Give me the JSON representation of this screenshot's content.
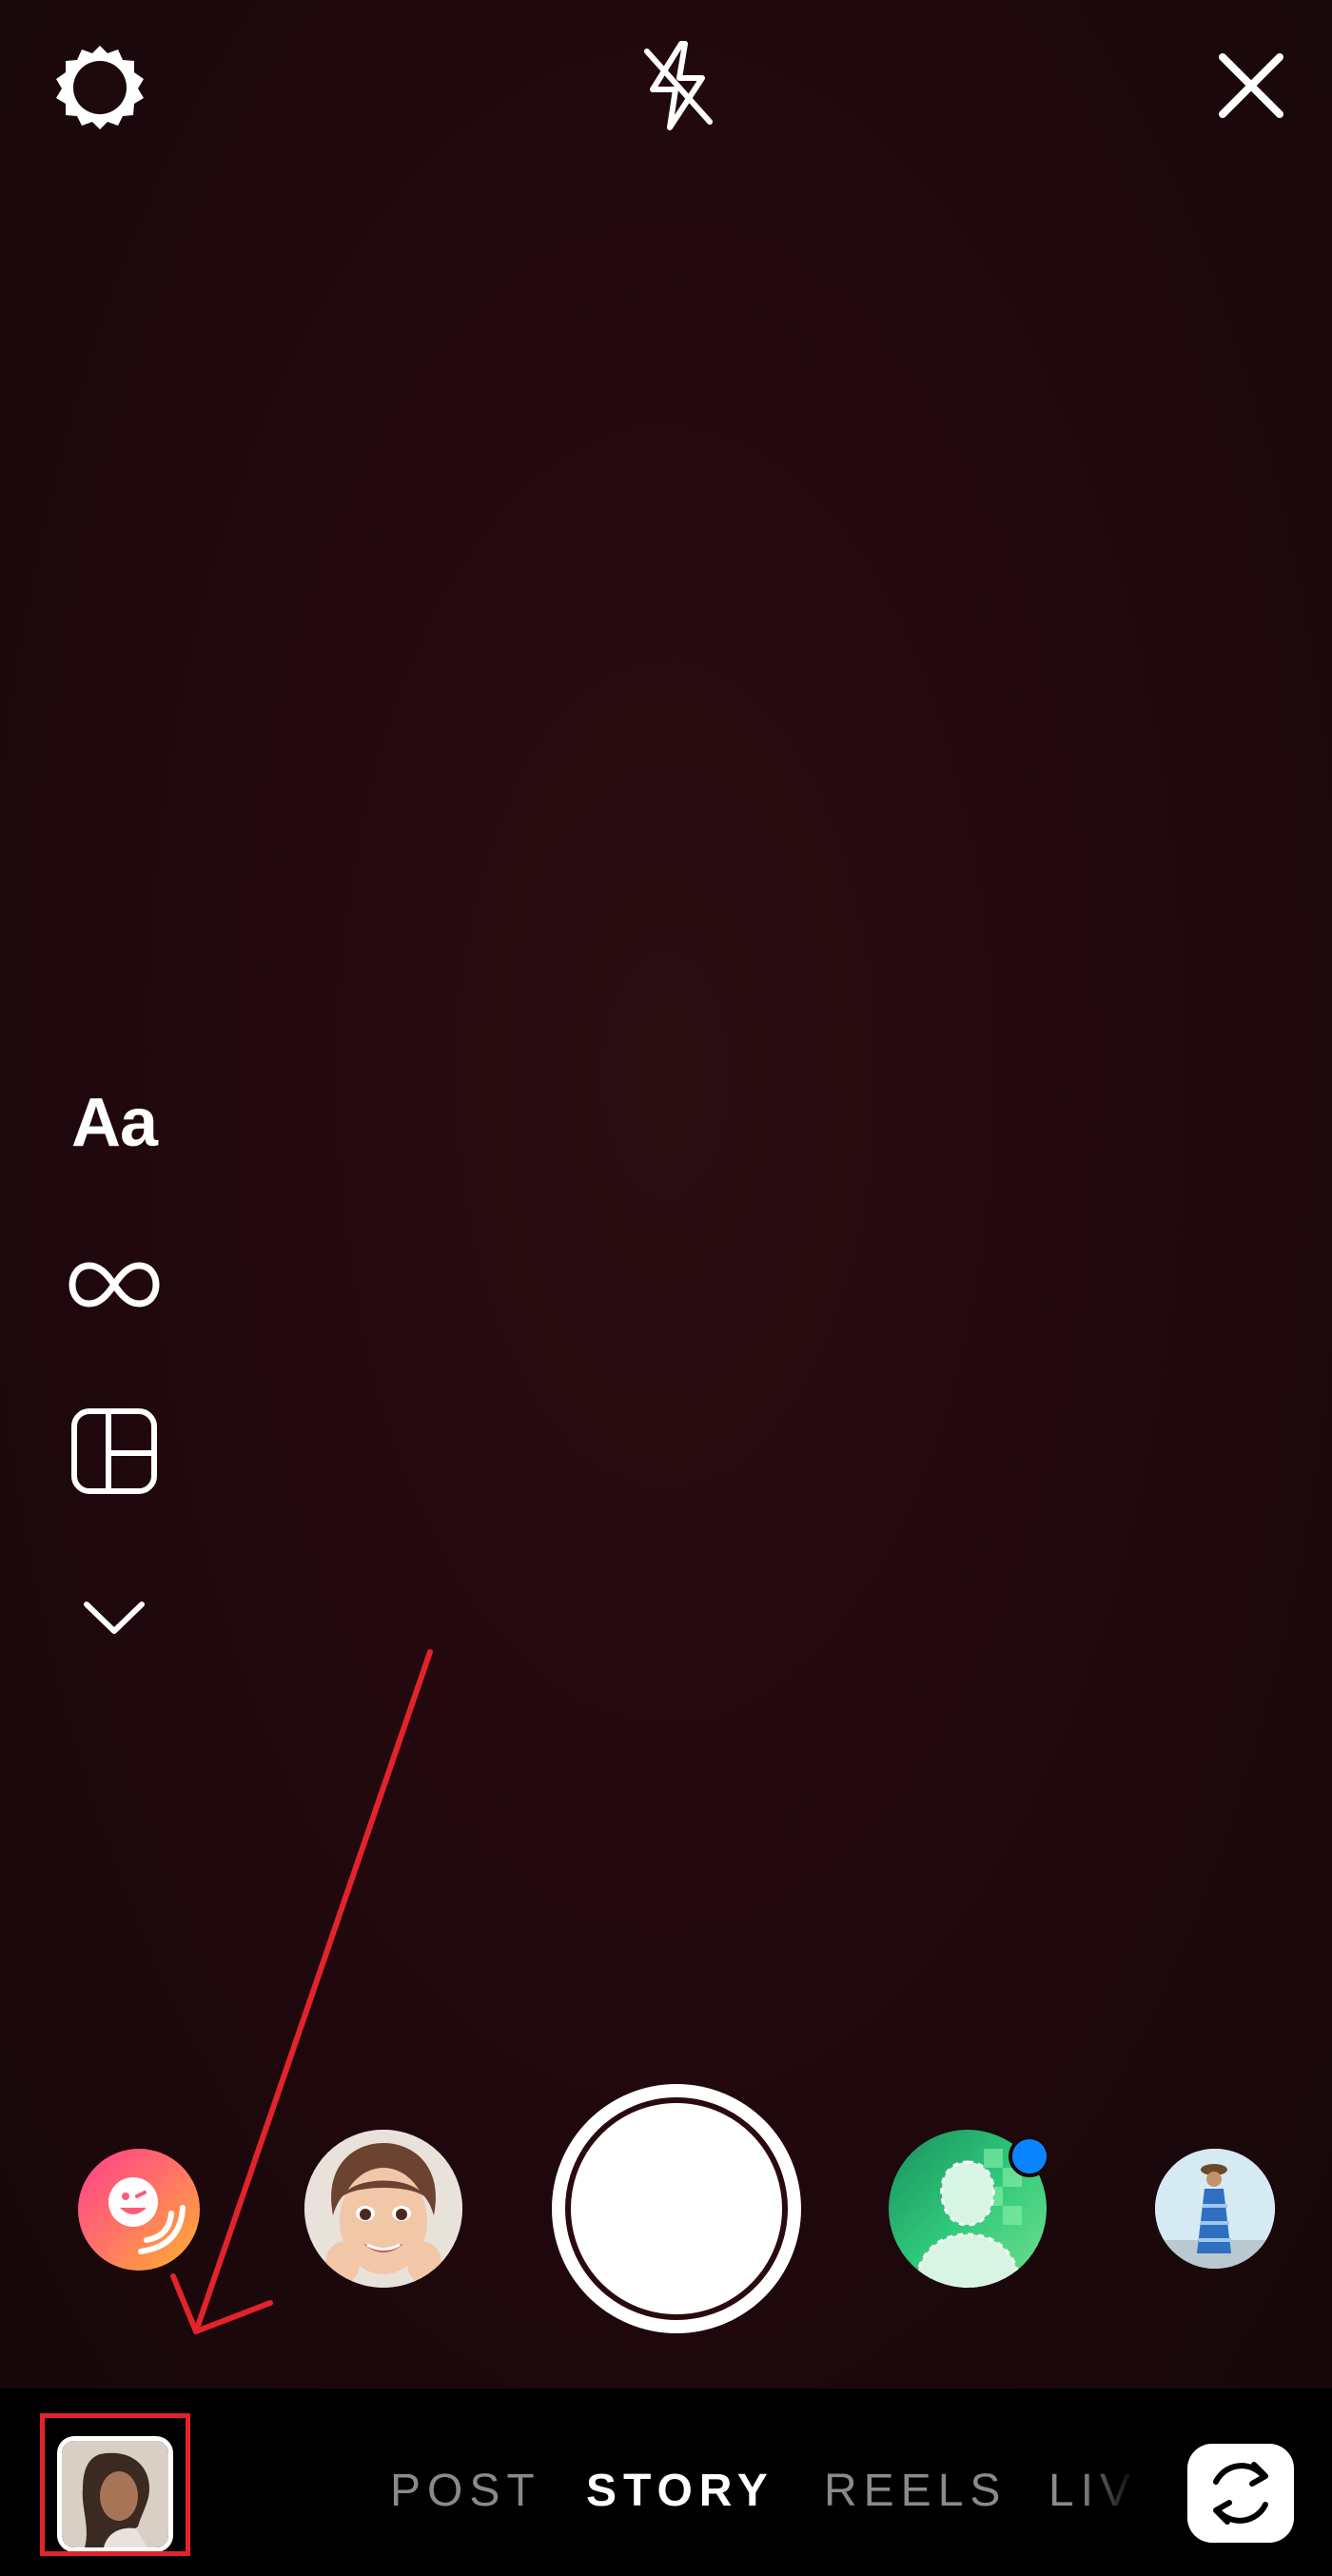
{
  "camera": {
    "top_bar": {
      "settings_icon": "gear-icon",
      "flash_icon": "flash-off-icon",
      "close_icon": "close-icon"
    },
    "left_tools": [
      {
        "name": "create-text-mode",
        "label": "Aa"
      },
      {
        "name": "boomerang-mode",
        "icon": "infinity-icon"
      },
      {
        "name": "layout-mode",
        "icon": "layout-icon"
      },
      {
        "name": "more-tools",
        "icon": "chevron-down-icon"
      }
    ],
    "effects": [
      {
        "name": "effect-stickers",
        "icon": "smiley-sticker-icon",
        "colors": [
          "#ff3d8b",
          "#ffb02e"
        ]
      },
      {
        "name": "effect-avatar-face",
        "icon": "avatar-face-icon"
      },
      {
        "name": "effect-background",
        "icon": "person-background-icon",
        "has_new_badge": true,
        "badge_color": "#0a84ff"
      },
      {
        "name": "effect-photo",
        "icon": "photo-thumbnail-icon"
      }
    ],
    "bottom_bar": {
      "modes": [
        {
          "label": "POST",
          "active": false
        },
        {
          "label": "STORY",
          "active": true
        },
        {
          "label": "REELS",
          "active": false
        },
        {
          "label": "LIVE",
          "active": false
        }
      ],
      "gallery_icon": "gallery-thumbnail-icon",
      "flip_icon": "flip-camera-icon"
    },
    "annotation": {
      "color": "#e3232b"
    }
  }
}
